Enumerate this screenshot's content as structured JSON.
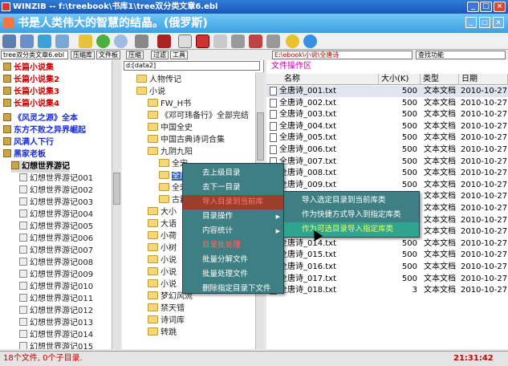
{
  "window": {
    "title": "WINZIB -- f:\\treebook\\书库1\\tree双分类文章6.ebl",
    "minimize": "_",
    "maximize": "□",
    "close": "×"
  },
  "banner": {
    "text": "书是人类伟大的智慧的结晶。(俄罗斯)",
    "min": "_",
    "restore": "□",
    "close": "×"
  },
  "addressbar": {
    "combo1": "tree双分类文章6.ebl",
    "buttons": [
      "压缩库",
      "文件板",
      "压缩",
      "过滤",
      "工具"
    ],
    "left_path": "d:[data2]",
    "right_path": "E:\\ebook\\小说\\全唐诗",
    "right_combo": "查找功能"
  },
  "left_tree": {
    "items": [
      {
        "label": "长篇小说集",
        "color": "#d00000"
      },
      {
        "label": "长篇小说集2",
        "color": "#d00000"
      },
      {
        "label": "长篇小说集3",
        "color": "#d00000"
      },
      {
        "label": "长篇小说集4",
        "color": "#d00000"
      },
      {
        "label": "《风灵之源》全本",
        "color": "#1a2fd0"
      },
      {
        "label": "东方不败之异界崛起",
        "color": "#1a2fd0"
      },
      {
        "label": "风满人下行",
        "color": "#1a2fd0"
      },
      {
        "label": "黑家老板",
        "color": "#1a2fd0"
      },
      {
        "label": "幻想世界游记",
        "color": "#000000"
      }
    ],
    "children": [
      "幻想世界游记001",
      "幻想世界游记002",
      "幻想世界游记003",
      "幻想世界游记004",
      "幻想世界游记005",
      "幻想世界游记006",
      "幻想世界游记007",
      "幻想世界游记008",
      "幻想世界游记009",
      "幻想世界游记010",
      "幻想世界游记011",
      "幻想世界游记012",
      "幻想世界游记013",
      "幻想世界游记014",
      "幻想世界游记015"
    ]
  },
  "middle_tree": {
    "items": [
      "人物传记",
      "小说",
      "FW_H书",
      "《邓可玮备行》全部完结",
      "中国全史",
      "中国古典诗词合集",
      "九阴九阳",
      "全宋",
      "全唐",
      "全宋",
      "古籍",
      "大小",
      "大语",
      "小荷",
      "小树",
      "小说",
      "小说",
      "小说",
      "梦幻风流",
      "禁天错",
      "诗词库",
      "转跳"
    ]
  },
  "right_panel": {
    "title": "文件操作区",
    "columns": {
      "name": "名称",
      "size": "大小(K)",
      "type": "类型",
      "date": "日期"
    },
    "files": [
      {
        "name": "全唐诗_001.txt",
        "size": "500",
        "type": "文本文档",
        "date": "2010-10-27"
      },
      {
        "name": "全唐诗_002.txt",
        "size": "500",
        "type": "文本文档",
        "date": "2010-10-27"
      },
      {
        "name": "全唐诗_003.txt",
        "size": "500",
        "type": "文本文档",
        "date": "2010-10-27"
      },
      {
        "name": "全唐诗_004.txt",
        "size": "500",
        "type": "文本文档",
        "date": "2010-10-27"
      },
      {
        "name": "全唐诗_005.txt",
        "size": "500",
        "type": "文本文档",
        "date": "2010-10-27"
      },
      {
        "name": "全唐诗_006.txt",
        "size": "500",
        "type": "文本文档",
        "date": "2010-10-27"
      },
      {
        "name": "全唐诗_007.txt",
        "size": "500",
        "type": "文本文档",
        "date": "2010-10-27"
      },
      {
        "name": "全唐诗_008.txt",
        "size": "500",
        "type": "文本文档",
        "date": "2010-10-27"
      },
      {
        "name": "全唐诗_009.txt",
        "size": "500",
        "type": "文本文档",
        "date": "2010-10-27"
      },
      {
        "name": "全唐诗_010.txt",
        "size": "500",
        "type": "文本文档",
        "date": "2010-10-27"
      },
      {
        "name": "全唐诗_011.txt",
        "size": "500",
        "type": "文本文档",
        "date": "2010-10-27"
      },
      {
        "name": "全唐诗_012.txt",
        "size": "500",
        "type": "文本文档",
        "date": "2010-10-27"
      },
      {
        "name": "全唐诗_013.txt",
        "size": "500",
        "type": "文本文档",
        "date": "2010-10-27"
      },
      {
        "name": "全唐诗_014.txt",
        "size": "500",
        "type": "文本文档",
        "date": "2010-10-27"
      },
      {
        "name": "全唐诗_015.txt",
        "size": "500",
        "type": "文本文档",
        "date": "2010-10-27"
      },
      {
        "name": "全唐诗_016.txt",
        "size": "500",
        "type": "文本文档",
        "date": "2010-10-27"
      },
      {
        "name": "全唐诗_017.txt",
        "size": "500",
        "type": "文本文档",
        "date": "2010-10-27"
      },
      {
        "name": "全唐诗_018.txt",
        "size": "3",
        "type": "文本文档",
        "date": "2010-10-27"
      }
    ]
  },
  "context_menu": {
    "items": [
      "去上级目录",
      "去下一目录",
      "导入目录到当前库",
      "目录操作",
      "内容统计",
      "目录批处理",
      "批量分解文件",
      "批量处理文件",
      "删除指定目录下文件"
    ],
    "submenu": [
      "导入选定目录到当前库类",
      "作为快捷方式导入到指定库类",
      "作为可选目录导入指定库类"
    ]
  },
  "status": {
    "left": "18个文件, 0个子目录.",
    "time": "21:31:42"
  },
  "colors": {
    "title_bg": "#1a56b8",
    "banner_bg": "#3ea0e0",
    "menu_bg": "#3d7f82",
    "menu_highlight": "#9b3f2c",
    "submenu_highlight": "#2fa48e",
    "status_text": "#d00000"
  }
}
